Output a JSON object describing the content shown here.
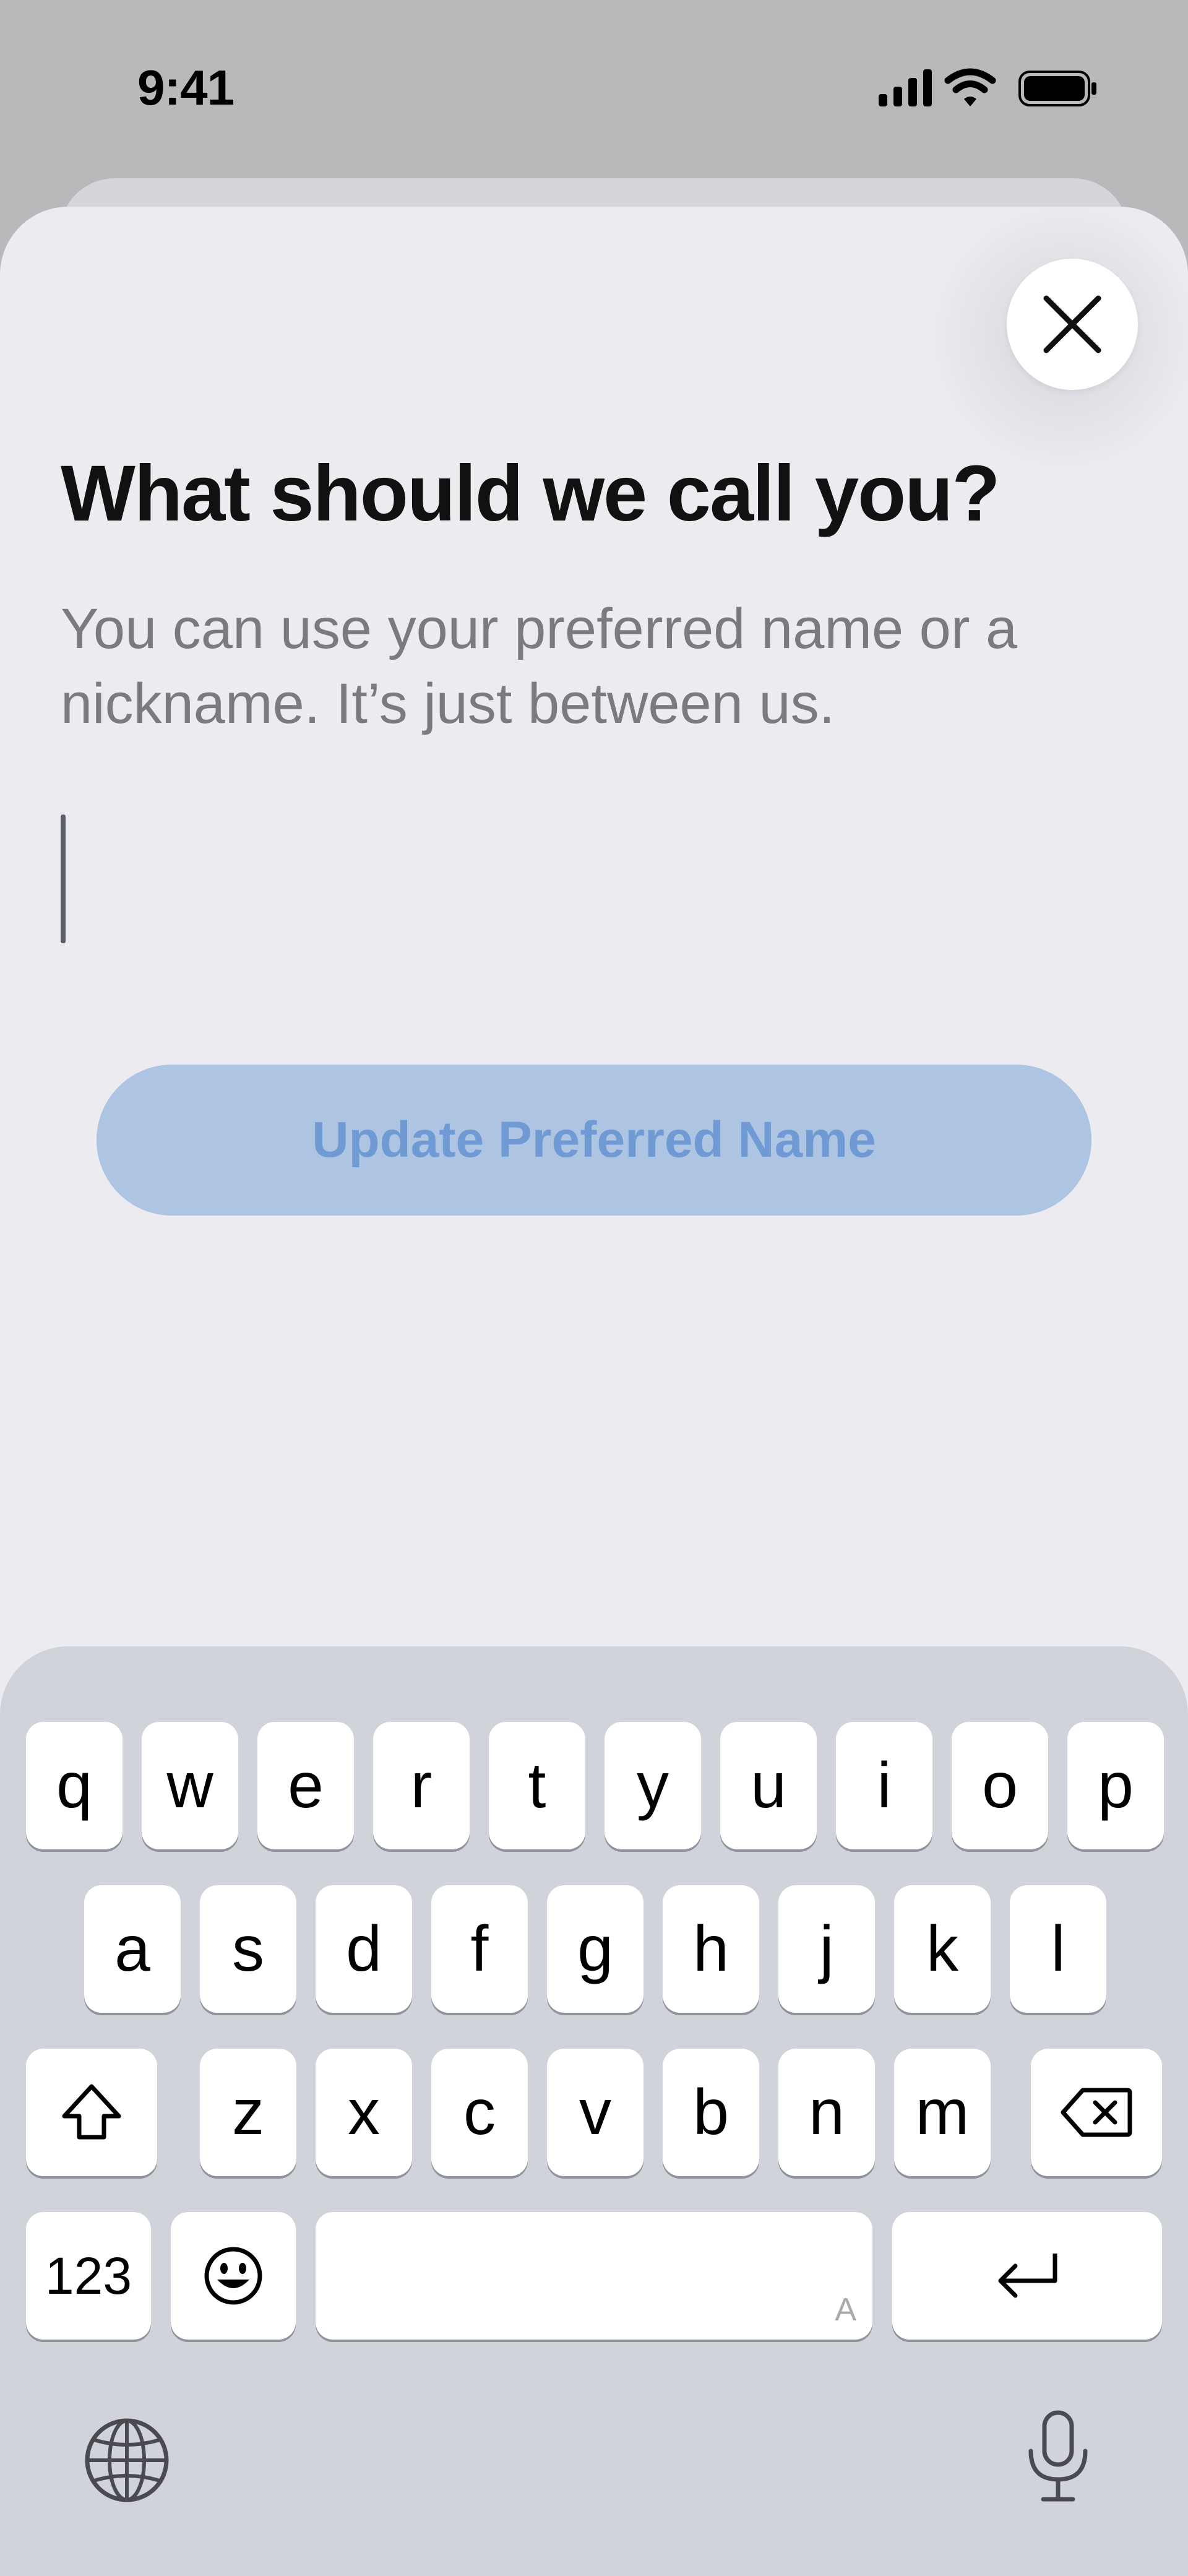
{
  "status_bar": {
    "time": "9:41",
    "icons": [
      "cellular-signal-icon",
      "wifi-icon",
      "battery-icon"
    ]
  },
  "sheet": {
    "close_icon": "close-icon",
    "title": "What should we call you?",
    "subtitle": "You can use your preferred name or a nickname. It’s just between us.",
    "name_input": {
      "value": "",
      "placeholder": ""
    },
    "update_button_label": "Update Preferred Name",
    "update_button_state": "disabled"
  },
  "keyboard": {
    "row1": [
      "q",
      "w",
      "e",
      "r",
      "t",
      "y",
      "u",
      "i",
      "o",
      "p"
    ],
    "row2": [
      "a",
      "s",
      "d",
      "f",
      "g",
      "h",
      "j",
      "k",
      "l"
    ],
    "row3": [
      "z",
      "x",
      "c",
      "v",
      "b",
      "n",
      "m"
    ],
    "numbers_key": "123",
    "space_hint": "A",
    "icons": [
      "shift-icon",
      "backspace-icon",
      "emoji-icon",
      "return-icon",
      "globe-icon",
      "microphone-icon"
    ]
  },
  "colors": {
    "sheet_background": "#ebebf0",
    "keyboard_background": "#d0d3da",
    "button_disabled_fill": "#adc5e2",
    "button_disabled_text": "#6f9ad4"
  }
}
